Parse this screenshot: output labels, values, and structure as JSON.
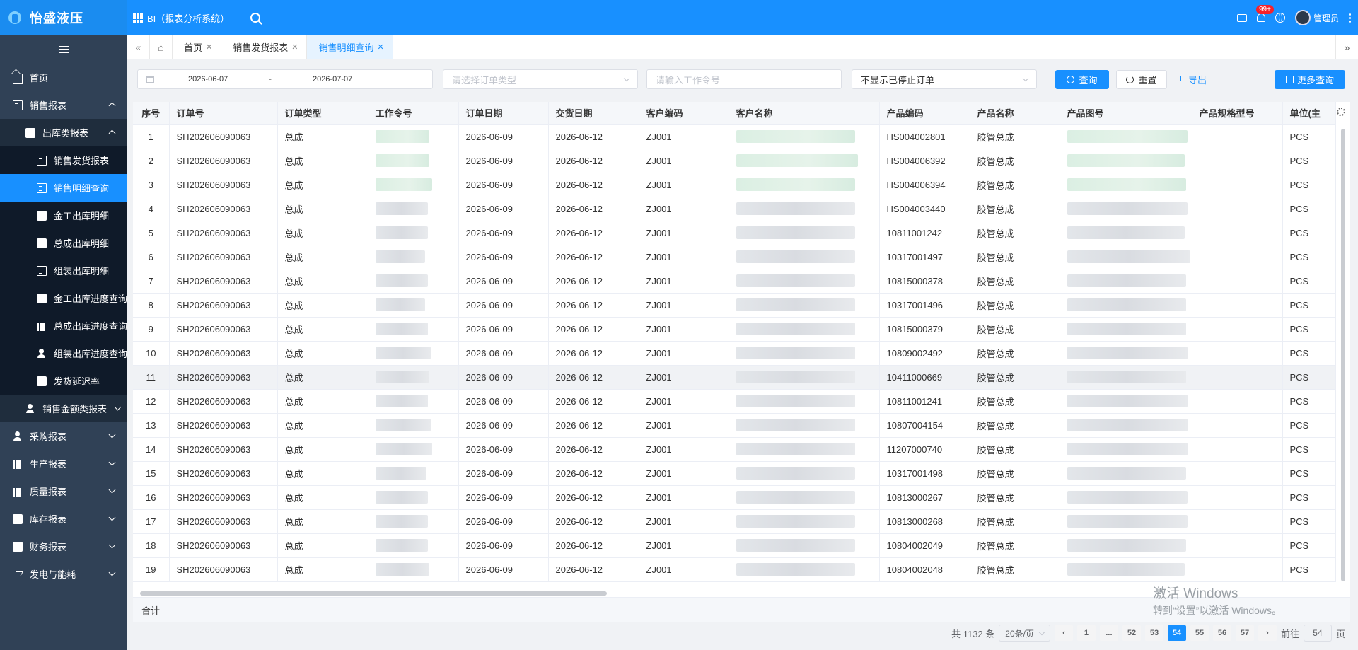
{
  "app": {
    "logo_text": "怡盛液压",
    "system_title": "BI（报表分析系统）"
  },
  "topbar": {
    "notification_badge": "99+",
    "user_name": "管理员"
  },
  "sidebar": {
    "home": "首页",
    "sales_reports": "销售报表",
    "outbound_reports": "出库类报表",
    "outbound_items": [
      "销售发货报表",
      "销售明细查询",
      "金工出库明细",
      "总成出库明细",
      "组装出库明细",
      "金工出库进度查询",
      "总成出库进度查询",
      "组装出库进度查询",
      "发货延迟率"
    ],
    "sales_amount_reports": "销售金额类报表",
    "groups": [
      "采购报表",
      "生产报表",
      "质量报表",
      "库存报表",
      "财务报表",
      "发电与能耗"
    ]
  },
  "tabs": [
    {
      "label": "首页"
    },
    {
      "label": "销售发货报表"
    },
    {
      "label": "销售明细查询"
    }
  ],
  "filters": {
    "date_start": "2026-06-07",
    "date_sep": "-",
    "date_end": "2026-07-07",
    "order_type_placeholder": "请选择订单类型",
    "work_order_placeholder": "请输入工作令号",
    "stopped_filter": "不显示已停止订单",
    "query_label": "查询",
    "reset_label": "重置",
    "export_label": "导出",
    "more_query_label": "更多查询"
  },
  "table": {
    "columns": [
      "序号",
      "订单号",
      "订单类型",
      "工作令号",
      "订单日期",
      "交货日期",
      "客户编码",
      "客户名称",
      "产品编码",
      "产品名称",
      "产品图号",
      "产品规格型号",
      "单位(主"
    ],
    "rows": [
      {
        "idx": "1",
        "order_no": "SH202606090063",
        "type": "总成",
        "order_date": "2026-06-09",
        "delivery_date": "2026-06-12",
        "customer_code": "ZJ001",
        "product_code": "HS004002801",
        "product_name": "胶管总成",
        "unit": "PCS"
      },
      {
        "idx": "2",
        "order_no": "SH202606090063",
        "type": "总成",
        "order_date": "2026-06-09",
        "delivery_date": "2026-06-12",
        "customer_code": "ZJ001",
        "product_code": "HS004006392",
        "product_name": "胶管总成",
        "unit": "PCS"
      },
      {
        "idx": "3",
        "order_no": "SH202606090063",
        "type": "总成",
        "order_date": "2026-06-09",
        "delivery_date": "2026-06-12",
        "customer_code": "ZJ001",
        "product_code": "HS004006394",
        "product_name": "胶管总成",
        "unit": "PCS"
      },
      {
        "idx": "4",
        "order_no": "SH202606090063",
        "type": "总成",
        "order_date": "2026-06-09",
        "delivery_date": "2026-06-12",
        "customer_code": "ZJ001",
        "product_code": "HS004003440",
        "product_name": "胶管总成",
        "unit": "PCS"
      },
      {
        "idx": "5",
        "order_no": "SH202606090063",
        "type": "总成",
        "order_date": "2026-06-09",
        "delivery_date": "2026-06-12",
        "customer_code": "ZJ001",
        "product_code": "10811001242",
        "product_name": "胶管总成",
        "unit": "PCS"
      },
      {
        "idx": "6",
        "order_no": "SH202606090063",
        "type": "总成",
        "order_date": "2026-06-09",
        "delivery_date": "2026-06-12",
        "customer_code": "ZJ001",
        "product_code": "10317001497",
        "product_name": "胶管总成",
        "unit": "PCS"
      },
      {
        "idx": "7",
        "order_no": "SH202606090063",
        "type": "总成",
        "order_date": "2026-06-09",
        "delivery_date": "2026-06-12",
        "customer_code": "ZJ001",
        "product_code": "10815000378",
        "product_name": "胶管总成",
        "unit": "PCS"
      },
      {
        "idx": "8",
        "order_no": "SH202606090063",
        "type": "总成",
        "order_date": "2026-06-09",
        "delivery_date": "2026-06-12",
        "customer_code": "ZJ001",
        "product_code": "10317001496",
        "product_name": "胶管总成",
        "unit": "PCS"
      },
      {
        "idx": "9",
        "order_no": "SH202606090063",
        "type": "总成",
        "order_date": "2026-06-09",
        "delivery_date": "2026-06-12",
        "customer_code": "ZJ001",
        "product_code": "10815000379",
        "product_name": "胶管总成",
        "unit": "PCS"
      },
      {
        "idx": "10",
        "order_no": "SH202606090063",
        "type": "总成",
        "order_date": "2026-06-09",
        "delivery_date": "2026-06-12",
        "customer_code": "ZJ001",
        "product_code": "10809002492",
        "product_name": "胶管总成",
        "unit": "PCS"
      },
      {
        "idx": "11",
        "order_no": "SH202606090063",
        "type": "总成",
        "order_date": "2026-06-09",
        "delivery_date": "2026-06-12",
        "customer_code": "ZJ001",
        "product_code": "10411000669",
        "product_name": "胶管总成",
        "unit": "PCS"
      },
      {
        "idx": "12",
        "order_no": "SH202606090063",
        "type": "总成",
        "order_date": "2026-06-09",
        "delivery_date": "2026-06-12",
        "customer_code": "ZJ001",
        "product_code": "10811001241",
        "product_name": "胶管总成",
        "unit": "PCS"
      },
      {
        "idx": "13",
        "order_no": "SH202606090063",
        "type": "总成",
        "order_date": "2026-06-09",
        "delivery_date": "2026-06-12",
        "customer_code": "ZJ001",
        "product_code": "10807004154",
        "product_name": "胶管总成",
        "unit": "PCS"
      },
      {
        "idx": "14",
        "order_no": "SH202606090063",
        "type": "总成",
        "order_date": "2026-06-09",
        "delivery_date": "2026-06-12",
        "customer_code": "ZJ001",
        "product_code": "11207000740",
        "product_name": "胶管总成",
        "unit": "PCS"
      },
      {
        "idx": "15",
        "order_no": "SH202606090063",
        "type": "总成",
        "order_date": "2026-06-09",
        "delivery_date": "2026-06-12",
        "customer_code": "ZJ001",
        "product_code": "10317001498",
        "product_name": "胶管总成",
        "unit": "PCS"
      },
      {
        "idx": "16",
        "order_no": "SH202606090063",
        "type": "总成",
        "order_date": "2026-06-09",
        "delivery_date": "2026-06-12",
        "customer_code": "ZJ001",
        "product_code": "10813000267",
        "product_name": "胶管总成",
        "unit": "PCS"
      },
      {
        "idx": "17",
        "order_no": "SH202606090063",
        "type": "总成",
        "order_date": "2026-06-09",
        "delivery_date": "2026-06-12",
        "customer_code": "ZJ001",
        "product_code": "10813000268",
        "product_name": "胶管总成",
        "unit": "PCS"
      },
      {
        "idx": "18",
        "order_no": "SH202606090063",
        "type": "总成",
        "order_date": "2026-06-09",
        "delivery_date": "2026-06-12",
        "customer_code": "ZJ001",
        "product_code": "10804002049",
        "product_name": "胶管总成",
        "unit": "PCS"
      },
      {
        "idx": "19",
        "order_no": "SH202606090063",
        "type": "总成",
        "order_date": "2026-06-09",
        "delivery_date": "2026-06-12",
        "customer_code": "ZJ001",
        "product_code": "10804002048",
        "product_name": "胶管总成",
        "unit": "PCS"
      }
    ],
    "summary_label": "合计"
  },
  "pagination": {
    "total_text": "共 1132 条",
    "page_size": "20条/页",
    "pages": [
      "1",
      "...",
      "52",
      "53",
      "54",
      "55",
      "56",
      "57"
    ],
    "current": "54",
    "goto_label": "前往",
    "goto_value": "54",
    "page_suffix": "页"
  },
  "watermark": {
    "line1": "激活 Windows",
    "line2": "转到“设置”以激活 Windows。"
  },
  "colors": {
    "primary": "#1890ff",
    "sidebar": "#304156",
    "sidebar_sub": "#1f2d3d"
  }
}
